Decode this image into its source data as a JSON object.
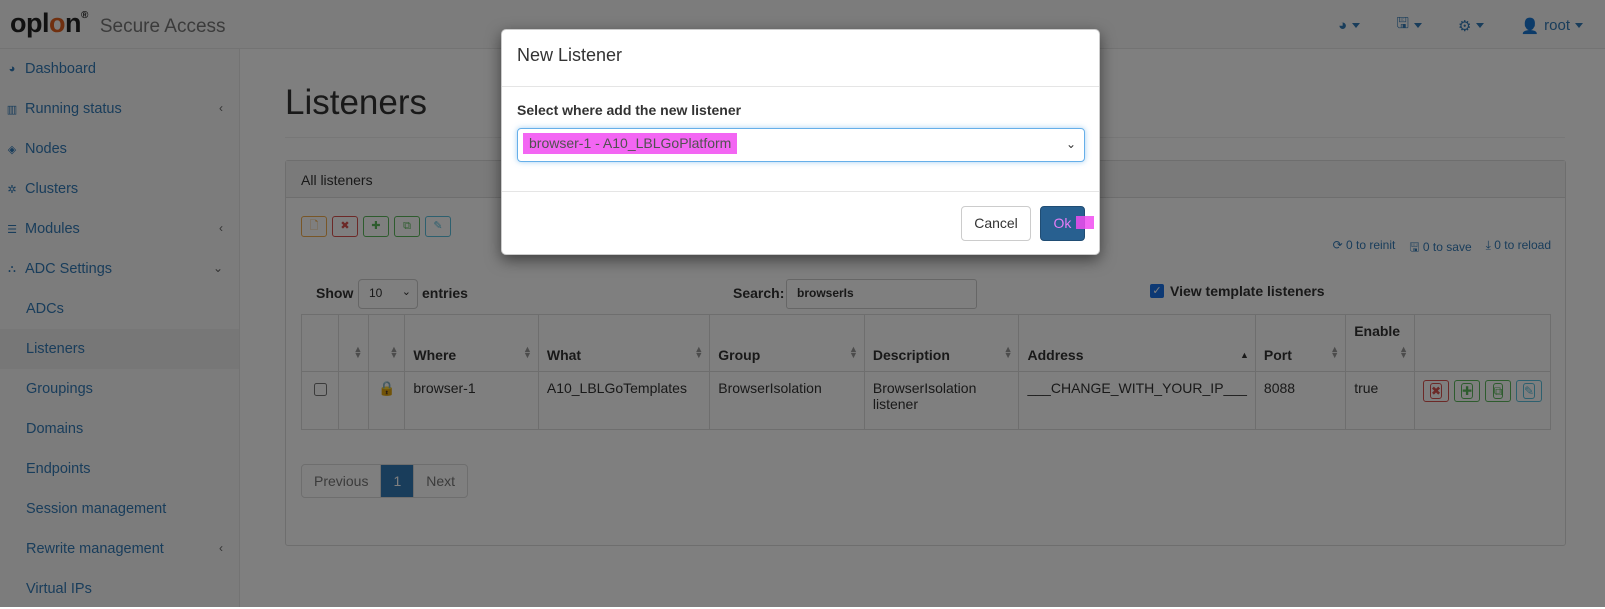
{
  "navbar": {
    "logo": "oplon",
    "product": "Secure Access",
    "user": "root",
    "icons": [
      "dashboard-icon",
      "save-icon",
      "gear-icon",
      "user-icon"
    ]
  },
  "sidebar": {
    "items": [
      {
        "label": "Dashboard",
        "icon": "dashboard-icon"
      },
      {
        "label": "Running status",
        "icon": "bar-chart-icon"
      },
      {
        "label": "Nodes",
        "icon": "cube-icon"
      },
      {
        "label": "Clusters",
        "icon": "cogs-icon"
      },
      {
        "label": "Modules",
        "icon": "list-icon"
      },
      {
        "label": "ADC Settings",
        "icon": "sitemap-icon"
      },
      {
        "label": "ADCs"
      },
      {
        "label": "Listeners"
      },
      {
        "label": "Groupings"
      },
      {
        "label": "Domains"
      },
      {
        "label": "Endpoints"
      },
      {
        "label": "Session management"
      },
      {
        "label": "Rewrite management"
      },
      {
        "label": "Virtual IPs"
      }
    ]
  },
  "page": {
    "title": "Listeners",
    "panel_title": "All listeners",
    "stats": {
      "reinit": "0 to reinit",
      "save": "0 to save",
      "reload": "0 to reload"
    },
    "show_label": "Show",
    "page_length": "10",
    "entries_label": "entries",
    "search_label": "Search:",
    "search_value": "browserIs",
    "view_template_label": "View template listeners"
  },
  "table": {
    "headers": [
      "",
      "",
      "",
      "Where",
      "What",
      "Group",
      "Description",
      "Address",
      "Port",
      "Enable",
      ""
    ],
    "rows": [
      {
        "where": "browser-1",
        "what": "A10_LBLGoTemplates",
        "group": "BrowserIsolation",
        "description": "BrowserIsolation listener",
        "address": "___CHANGE_WITH_YOUR_IP___",
        "port": "8088",
        "enable": "true"
      }
    ]
  },
  "pagination": {
    "previous": "Previous",
    "current": "1",
    "next": "Next"
  },
  "modal": {
    "title": "New Listener",
    "label": "Select where add the new listener",
    "selected": "browser-1 - A10_LBLGoPlatform",
    "cancel": "Cancel",
    "ok": "Ok"
  },
  "colors": {
    "link": "#337ab7",
    "primary": "#286090",
    "highlight": "#f14cf1",
    "danger": "#d9534f",
    "success": "#5cb85c",
    "info": "#5bc0de",
    "warning": "#f0ad4e"
  }
}
